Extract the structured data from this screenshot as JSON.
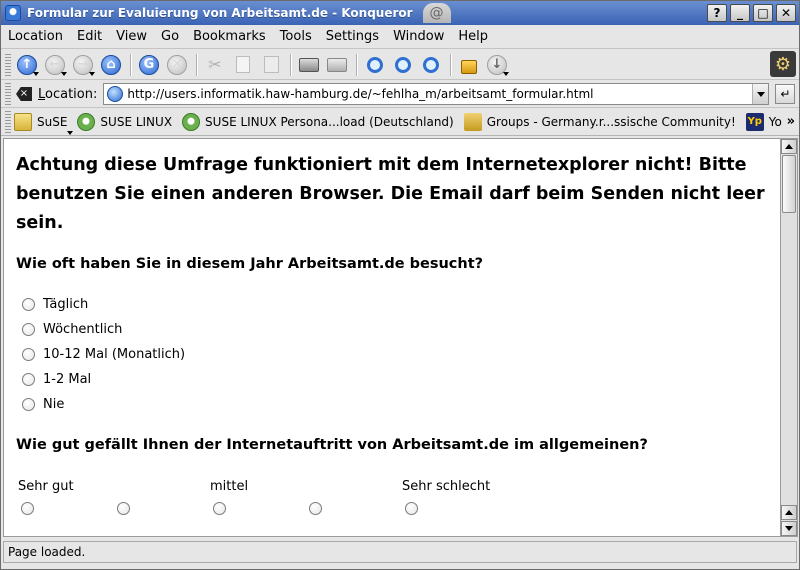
{
  "window": {
    "title": "Formular zur Evaluierung von Arbeitsamt.de - Konqueror",
    "buttons": [
      "?",
      "_",
      "□",
      "✕"
    ]
  },
  "menu": [
    "Location",
    "Edit",
    "View",
    "Go",
    "Bookmarks",
    "Tools",
    "Settings",
    "Window",
    "Help"
  ],
  "location": {
    "label_pre": "L",
    "label_rest": "ocation:",
    "url": "http://users.informatik.haw-hamburg.de/~fehlha_m/arbeitsamt_formular.html"
  },
  "bookmarks": [
    {
      "label": "SuSE",
      "icon": "folder-icon"
    },
    {
      "label": "SUSE LINUX",
      "icon": "suse-icon"
    },
    {
      "label": "SUSE LINUX Persona...load (Deutschland)",
      "icon": "suse-icon"
    },
    {
      "label": "Groups - Germany.r...ssische Community!",
      "icon": "groups-icon"
    },
    {
      "label": "Yo",
      "icon": "yp-icon"
    }
  ],
  "page": {
    "warning": "Achtung diese Umfrage funktioniert mit dem Internetexplorer nicht! Bitte benutzen Sie einen anderen Browser. Die Email darf beim Senden nicht leer sein.",
    "q1": "Wie oft haben Sie in diesem Jahr Arbeitsamt.de besucht?",
    "q1_options": [
      "Täglich",
      "Wöchentlich",
      "10-12 Mal (Monatlich)",
      "1-2 Mal",
      "Nie"
    ],
    "q2": "Wie gut gefällt Ihnen der Internetauftritt von Arbeitsamt.de im allgemeinen?",
    "q2_scale": {
      "left": "Sehr gut",
      "mid": "mittel",
      "right": "Sehr schlecht"
    }
  },
  "status": "Page loaded."
}
